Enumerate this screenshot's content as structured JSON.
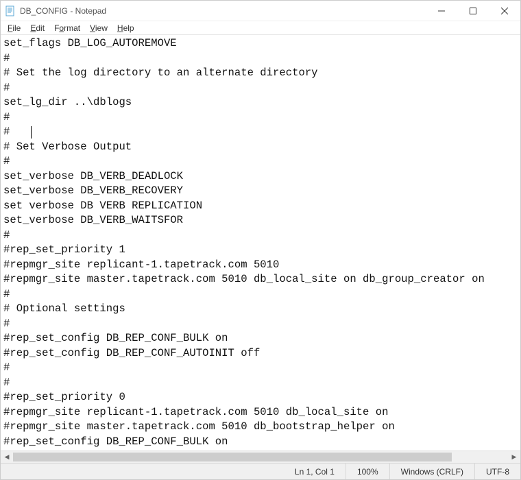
{
  "window": {
    "title": "DB_CONFIG - Notepad"
  },
  "menu": {
    "file": "File",
    "edit": "Edit",
    "format": "Format",
    "view": "View",
    "help": "Help"
  },
  "content": {
    "lines": [
      "set_flags DB_LOG_AUTOREMOVE",
      "#",
      "# Set the log directory to an alternate directory",
      "#",
      "set_lg_dir ..\\dblogs",
      "#",
      "#",
      "# Set Verbose Output",
      "#",
      "set_verbose DB_VERB_DEADLOCK",
      "set_verbose DB_VERB_RECOVERY",
      "set verbose DB VERB REPLICATION",
      "set_verbose DB_VERB_WAITSFOR",
      "#",
      "#rep_set_priority 1",
      "#repmgr_site replicant-1.tapetrack.com 5010",
      "#repmgr_site master.tapetrack.com 5010 db_local_site on db_group_creator on",
      "#",
      "# Optional settings",
      "#",
      "#rep_set_config DB_REP_CONF_BULK on",
      "#rep_set_config DB_REP_CONF_AUTOINIT off",
      "#",
      "#",
      "#rep_set_priority 0",
      "#repmgr_site replicant-1.tapetrack.com 5010 db_local_site on",
      "#repmgr_site master.tapetrack.com 5010 db_bootstrap_helper on",
      "#rep_set_config DB_REP_CONF_BULK on"
    ]
  },
  "status": {
    "position": "Ln 1, Col 1",
    "zoom": "100%",
    "line_ending": "Windows (CRLF)",
    "encoding": "UTF-8"
  }
}
